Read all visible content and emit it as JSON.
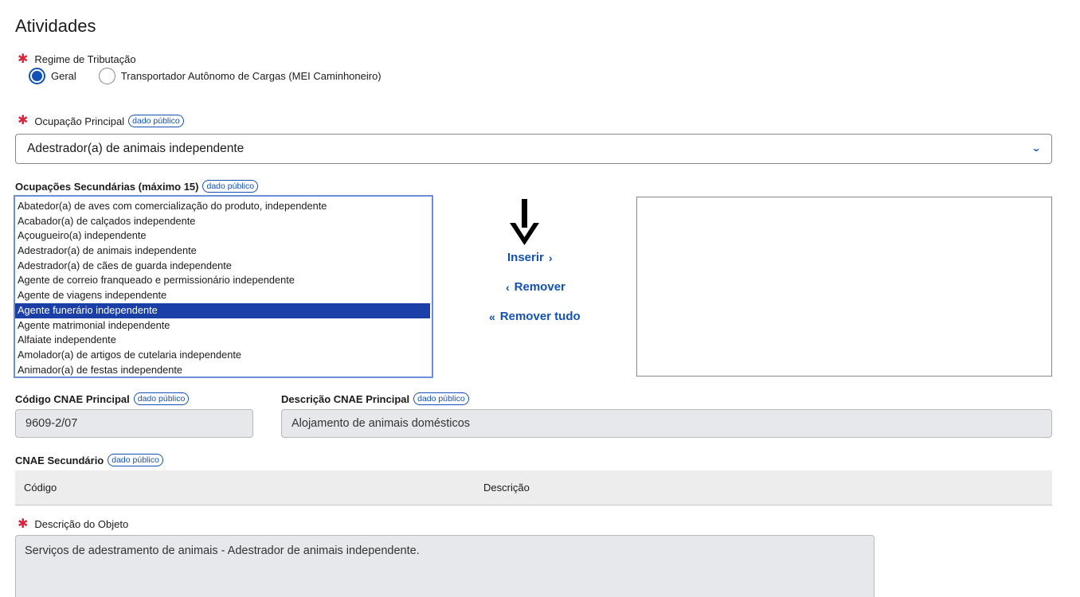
{
  "section": {
    "title": "Atividades"
  },
  "regime": {
    "label": "Regime de Tributação",
    "options": [
      "Geral",
      "Transportador Autônomo de Cargas (MEI Caminhoneiro)"
    ],
    "selected": "Geral"
  },
  "badge_text": "dado público",
  "ocupacao_principal": {
    "label": "Ocupação Principal",
    "value": "Adestrador(a) de animais independente"
  },
  "ocupacoes_secundarias": {
    "label": "Ocupações Secundárias (máximo 15)",
    "options": [
      "Abatedor(a) de aves com comercialização do produto, independente",
      "Acabador(a) de calçados independente",
      "Açougueiro(a) independente",
      "Adestrador(a) de animais independente",
      "Adestrador(a) de cães de guarda independente",
      "Agente de correio franqueado e permissionário independente",
      "Agente de viagens independente",
      "Agente funerário independente",
      "Agente matrimonial independente",
      "Alfaiate independente",
      "Amolador(a) de artigos de cutelaria independente",
      "Animador(a) de festas independente"
    ],
    "selected": "Agente funerário independente"
  },
  "actions": {
    "inserir": "Inserir",
    "remover": "Remover",
    "remover_tudo": "Remover tudo"
  },
  "cnae_principal": {
    "codigo_label": "Código CNAE Principal",
    "codigo_value": "9609-2/07",
    "descricao_label": "Descrição CNAE Principal",
    "descricao_value": "Alojamento de animais domésticos"
  },
  "cnae_secundario": {
    "label": "CNAE Secundário",
    "columns": [
      "Código",
      "Descrição"
    ]
  },
  "descricao_objeto": {
    "label": "Descrição do Objeto",
    "value": "Serviços de adestramento de animais - Adestrador de animais independente."
  },
  "colors": {
    "accent": "#1351b4",
    "selected_row": "#1a3fa6",
    "required": "#d7263d",
    "readonly_bg": "#e6e8ec"
  }
}
